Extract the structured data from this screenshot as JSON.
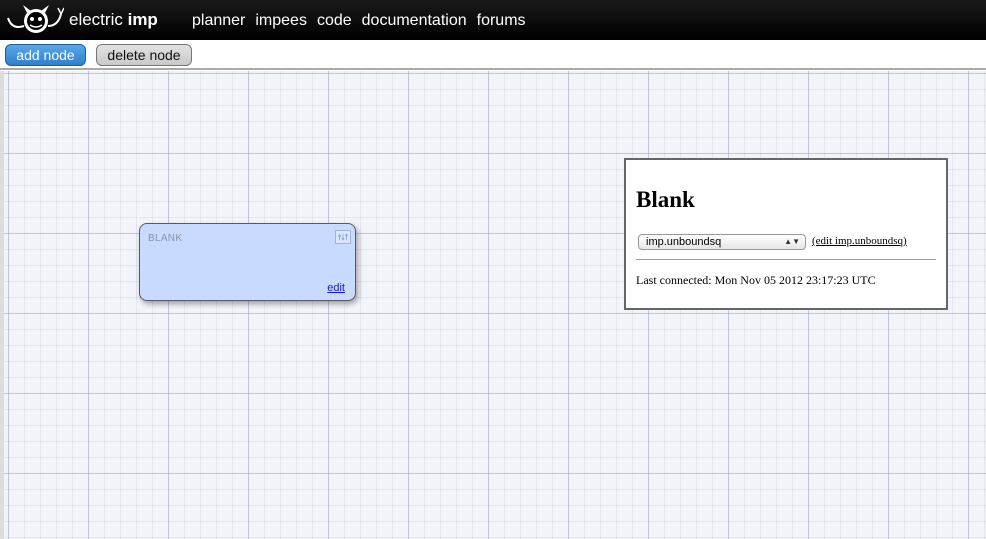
{
  "navbar": {
    "brand_light": "electric",
    "brand_bold": "imp",
    "logo_icon": "electric-imp-logo-icon",
    "links": [
      {
        "label": "planner"
      },
      {
        "label": "impees"
      },
      {
        "label": "code"
      },
      {
        "label": "documentation"
      },
      {
        "label": "forums"
      }
    ]
  },
  "toolbar": {
    "add_label": "add node",
    "delete_label": "delete node"
  },
  "colors": {
    "accent": "#2f7fcc",
    "node_fill": "#c9daff",
    "navbar_bg": "#000000"
  },
  "node": {
    "title": "BLANK",
    "settings_icon": "settings-sliders-icon",
    "edit_label": "edit"
  },
  "panel": {
    "title": "Blank",
    "select_value": "imp.unboundsq",
    "edit_link": "(edit imp.unboundsq)",
    "status": "Last connected: Mon Nov 05 2012 23:17:23 UTC"
  }
}
